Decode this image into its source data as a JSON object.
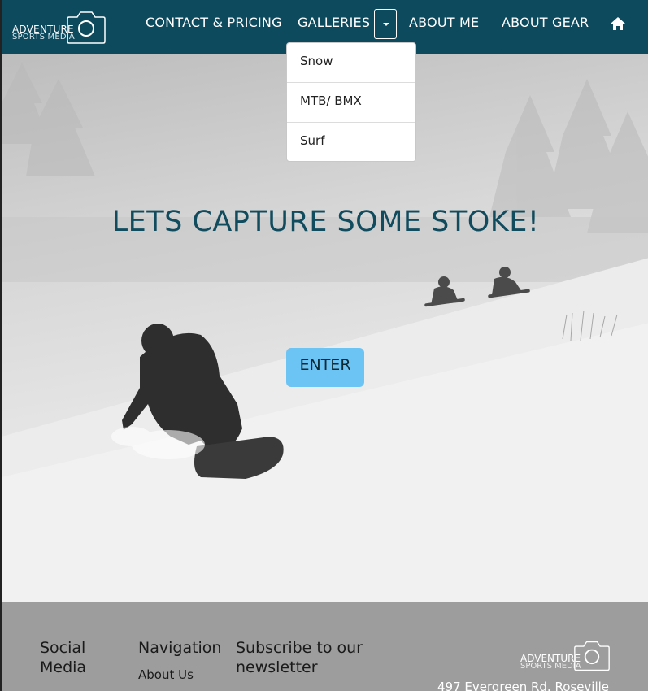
{
  "brand": {
    "line1": "ADVENTURE",
    "line2": "SPORTS MEDIA"
  },
  "nav": {
    "contact": "CONTACT & PRICING",
    "galleries": "GALLERIES",
    "about_me": "ABOUT ME",
    "about_gear": "ABOUT GEAR",
    "home_icon": "home-icon"
  },
  "dropdown": {
    "items": [
      "Snow",
      "MTB/ BMX",
      "Surf"
    ]
  },
  "hero": {
    "title": "LETS CAPTURE SOME STOKE!",
    "button": "ENTER"
  },
  "footer": {
    "social_heading": "Social Media",
    "navigation_heading": "Navigation",
    "subscribe_heading": "Subscribe to our newsletter",
    "about_link": "About Us",
    "address": "497 Evergreen Rd. Roseville"
  },
  "colors": {
    "navbar": "#0e4a5d",
    "title": "#114b5e",
    "button": "#6cc4f5",
    "footer": "#9d9d9d"
  }
}
